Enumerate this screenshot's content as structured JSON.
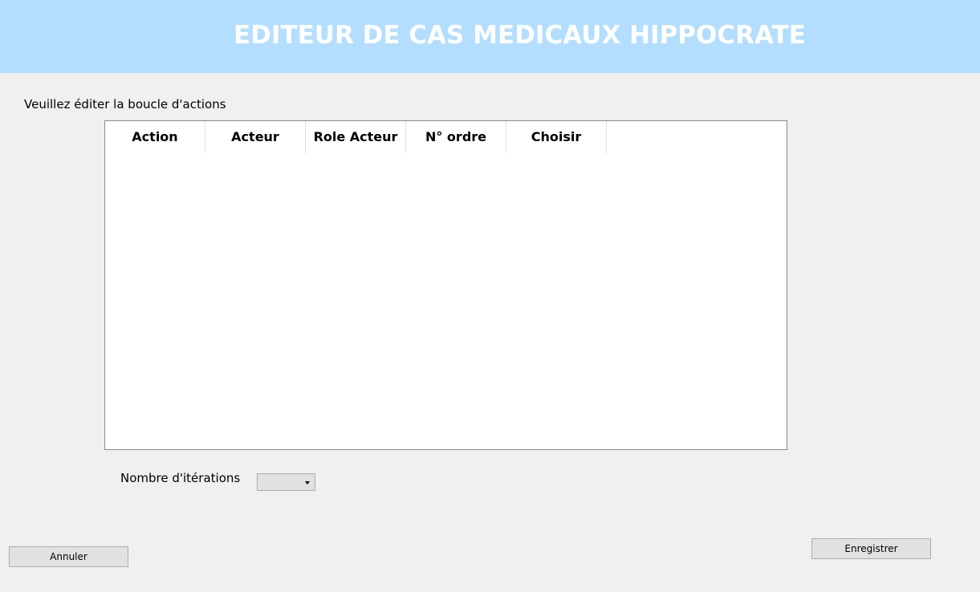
{
  "header": {
    "title": "EDITEUR DE CAS MEDICAUX HIPPOCRATE",
    "bg_color": "#b3deff"
  },
  "prompt": "Veuillez éditer la boucle d'actions",
  "table": {
    "columns": [
      "Action",
      "Acteur",
      "Role Acteur",
      "N° ordre",
      "Choisir"
    ],
    "rows": []
  },
  "iterations": {
    "label": "Nombre d'itérations",
    "selected_value": ""
  },
  "buttons": {
    "cancel": "Annuler",
    "save": "Enregistrer"
  }
}
